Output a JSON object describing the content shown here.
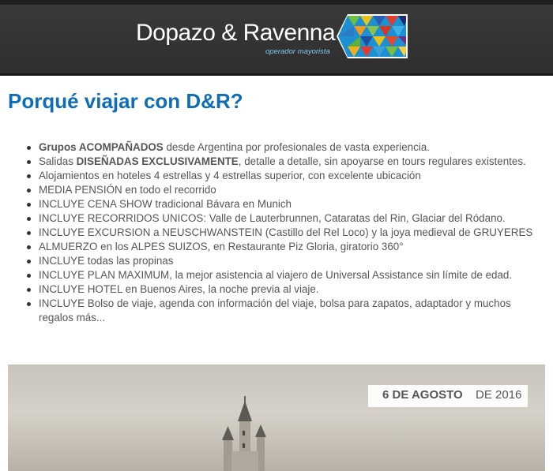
{
  "header": {
    "brand_name": "Dopazo & Ravenna",
    "brand_tagline": "operador mayorista",
    "logo_icon": "mosaic-arrow-icon",
    "colors": {
      "bar": "#333333",
      "tagline": "#7ec8f0"
    }
  },
  "main": {
    "title": "Porqué viajar con D&R?",
    "title_color": "#0f6db8",
    "features": [
      {
        "bold": "Grupos ACOMPAÑADOS",
        "pre": "",
        "post": " desde Argentina por profesionales de vasta experiencia."
      },
      {
        "bold": "DISEÑADAS EXCLUSIVAMENTE",
        "pre": "Salidas ",
        "post": ", detalle a detalle, sin apoyarse en tours regulares existentes."
      },
      {
        "bold": "",
        "pre": "Alojamientos en hoteles 4 estrellas y 4 estrellas superior, con excelente ubicación",
        "post": ""
      },
      {
        "bold": "",
        "pre": "MEDIA PENSIÓN en todo el recorrido",
        "post": ""
      },
      {
        "bold": "",
        "pre": "INCLUYE CENA SHOW tradicional Bávara en Munich",
        "post": ""
      },
      {
        "bold": "",
        "pre": "INCLUYE RECORRIDOS UNICOS: Valle de Lauterbrunnen, Cataratas del Rin, Glaciar del Ródano.",
        "post": ""
      },
      {
        "bold": "",
        "pre": "INCLUYE EXCURSION a NEUSCHWANSTEIN (Castillo del Rel Loco) y la joya medieval de GRUYERES",
        "post": ""
      },
      {
        "bold": "",
        "pre": "ALMUERZO en los ALPES SUIZOS, en Restaurante Piz Gloria, giratorio 360°",
        "post": ""
      },
      {
        "bold": "",
        "pre": "INCLUYE todas las propinas",
        "post": ""
      },
      {
        "bold": "",
        "pre": "INCLUYE PLAN MAXIMUM, la mejor asistencia al viajero de Universal Assistance sin límite de edad.",
        "post": ""
      },
      {
        "bold": "",
        "pre": "INCLUYE HOTEL en Buenos Aires, la noche previa al viaje.",
        "post": ""
      },
      {
        "bold": "",
        "pre": "INCLUYE Bolso de viaje, agenda con información del viaje, bolsa para zapatos, adaptador y muchos regalos más...",
        "post": ""
      }
    ]
  },
  "banner": {
    "date_bold": "6 DE AGOSTO",
    "date_light": " DE 2016",
    "image_icon": "castle-photo"
  }
}
